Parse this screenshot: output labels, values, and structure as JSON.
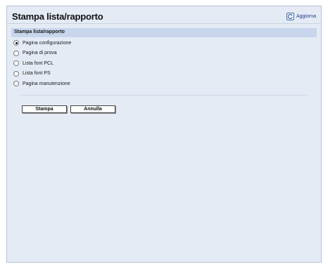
{
  "header": {
    "title": "Stampa lista/rapporto",
    "refresh_label": "Aggiorna"
  },
  "section": {
    "title": "Stampa lista/rapporto"
  },
  "options": [
    {
      "label": "Pagina configurazione",
      "checked": true
    },
    {
      "label": "Pagina di prova",
      "checked": false
    },
    {
      "label": "Lista font PCL",
      "checked": false
    },
    {
      "label": "Lista font PS",
      "checked": false
    },
    {
      "label": "Pagina manutenzione",
      "checked": false
    }
  ],
  "buttons": {
    "print": "Stampa",
    "cancel": "Annulla"
  },
  "icons": {
    "refresh": "refresh-icon"
  },
  "colors": {
    "background": "#e4ebf5",
    "section_bar": "#c7d6ec",
    "link": "#223a8a"
  }
}
